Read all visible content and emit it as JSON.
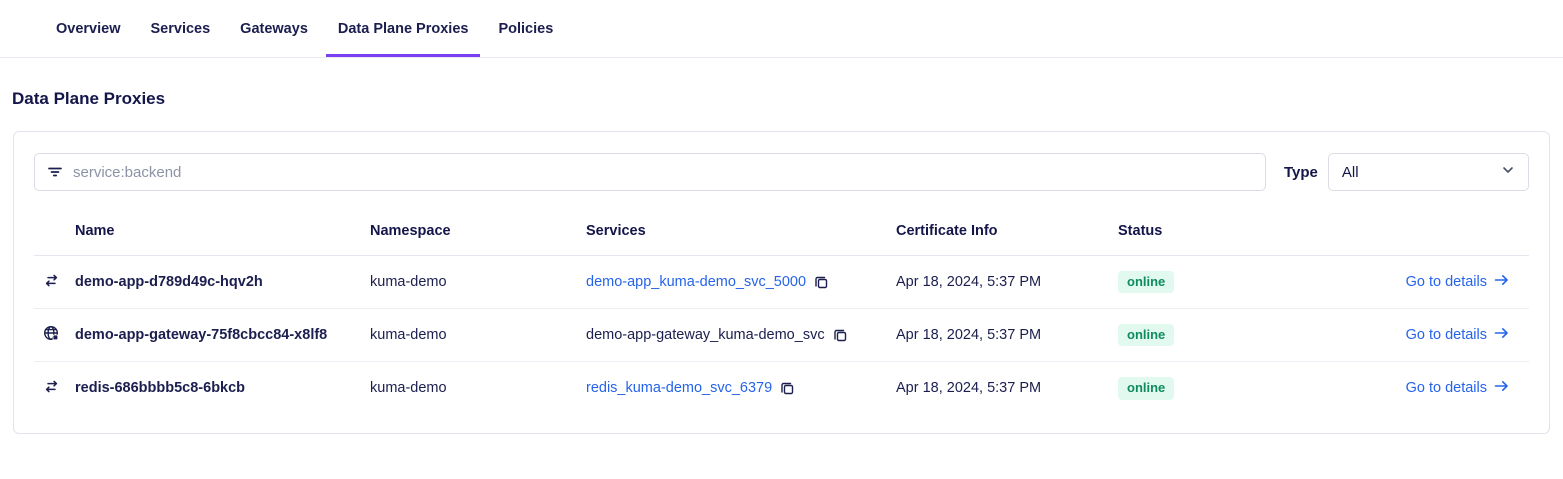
{
  "tabs": {
    "items": [
      {
        "label": "Overview",
        "active": false
      },
      {
        "label": "Services",
        "active": false
      },
      {
        "label": "Gateways",
        "active": false
      },
      {
        "label": "Data Plane Proxies",
        "active": true
      },
      {
        "label": "Policies",
        "active": false
      }
    ]
  },
  "page": {
    "title": "Data Plane Proxies"
  },
  "filters": {
    "search_placeholder": "service:backend",
    "type_label": "Type",
    "type_value": "All"
  },
  "table": {
    "columns": {
      "name": "Name",
      "namespace": "Namespace",
      "services": "Services",
      "certificate_info": "Certificate Info",
      "status": "Status"
    },
    "go_to_details_label": "Go to details",
    "rows": [
      {
        "icon": "sidecar-proxy",
        "name": "demo-app-d789d49c-hqv2h",
        "namespace": "kuma-demo",
        "service": "demo-app_kuma-demo_svc_5000",
        "service_is_link": true,
        "certificate_info": "Apr 18, 2024, 5:37 PM",
        "status": "online"
      },
      {
        "icon": "gateway",
        "name": "demo-app-gateway-75f8cbcc84-x8lf8",
        "namespace": "kuma-demo",
        "service": "demo-app-gateway_kuma-demo_svc",
        "service_is_link": false,
        "certificate_info": "Apr 18, 2024, 5:37 PM",
        "status": "online"
      },
      {
        "icon": "sidecar-proxy",
        "name": "redis-686bbbb5c8-6bkcb",
        "namespace": "kuma-demo",
        "service": "redis_kuma-demo_svc_6379",
        "service_is_link": true,
        "certificate_info": "Apr 18, 2024, 5:37 PM",
        "status": "online"
      }
    ]
  },
  "colors": {
    "accent_purple": "#7b3ff2",
    "link_blue": "#2563eb",
    "status_online_text": "#0e8b61",
    "status_online_bg": "#e2f9ef",
    "text_navy": "#1b1e4e"
  }
}
